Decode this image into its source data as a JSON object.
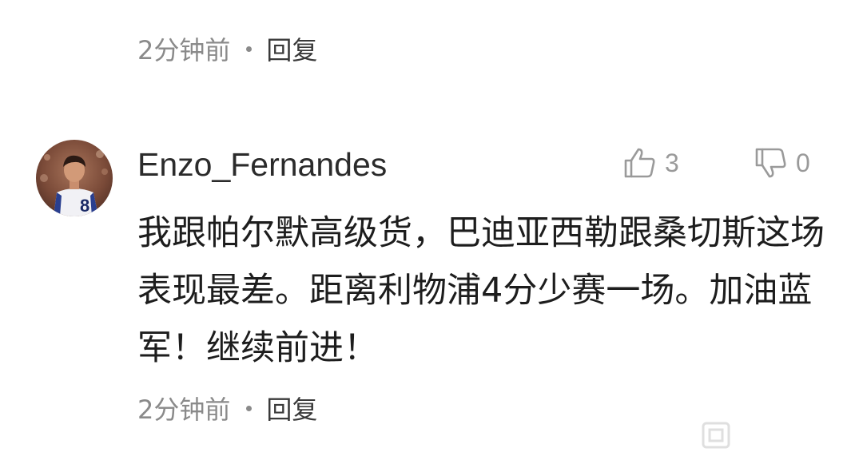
{
  "top_meta": {
    "time": "2分钟前",
    "reply_label": "回复"
  },
  "comment": {
    "username": "Enzo_Fernandes",
    "avatar_jersey_number": "8",
    "likes": "3",
    "dislikes": "0",
    "text": "我跟帕尔默高级货，巴迪亚西勒跟桑切斯这场表现最差。距离利物浦4分少赛一场。加油蓝军！继续前进！",
    "time": "2分钟前",
    "reply_label": "回复"
  },
  "colors": {
    "meta_text": "#8a8a8a",
    "reply_text": "#3a3a3a",
    "username": "#2b2b2b",
    "body_text": "#1d1d1d",
    "vote_icon": "#9a9a9a"
  },
  "icons": {
    "like": "thumbs-up-outline",
    "dislike": "thumbs-down-outline"
  }
}
